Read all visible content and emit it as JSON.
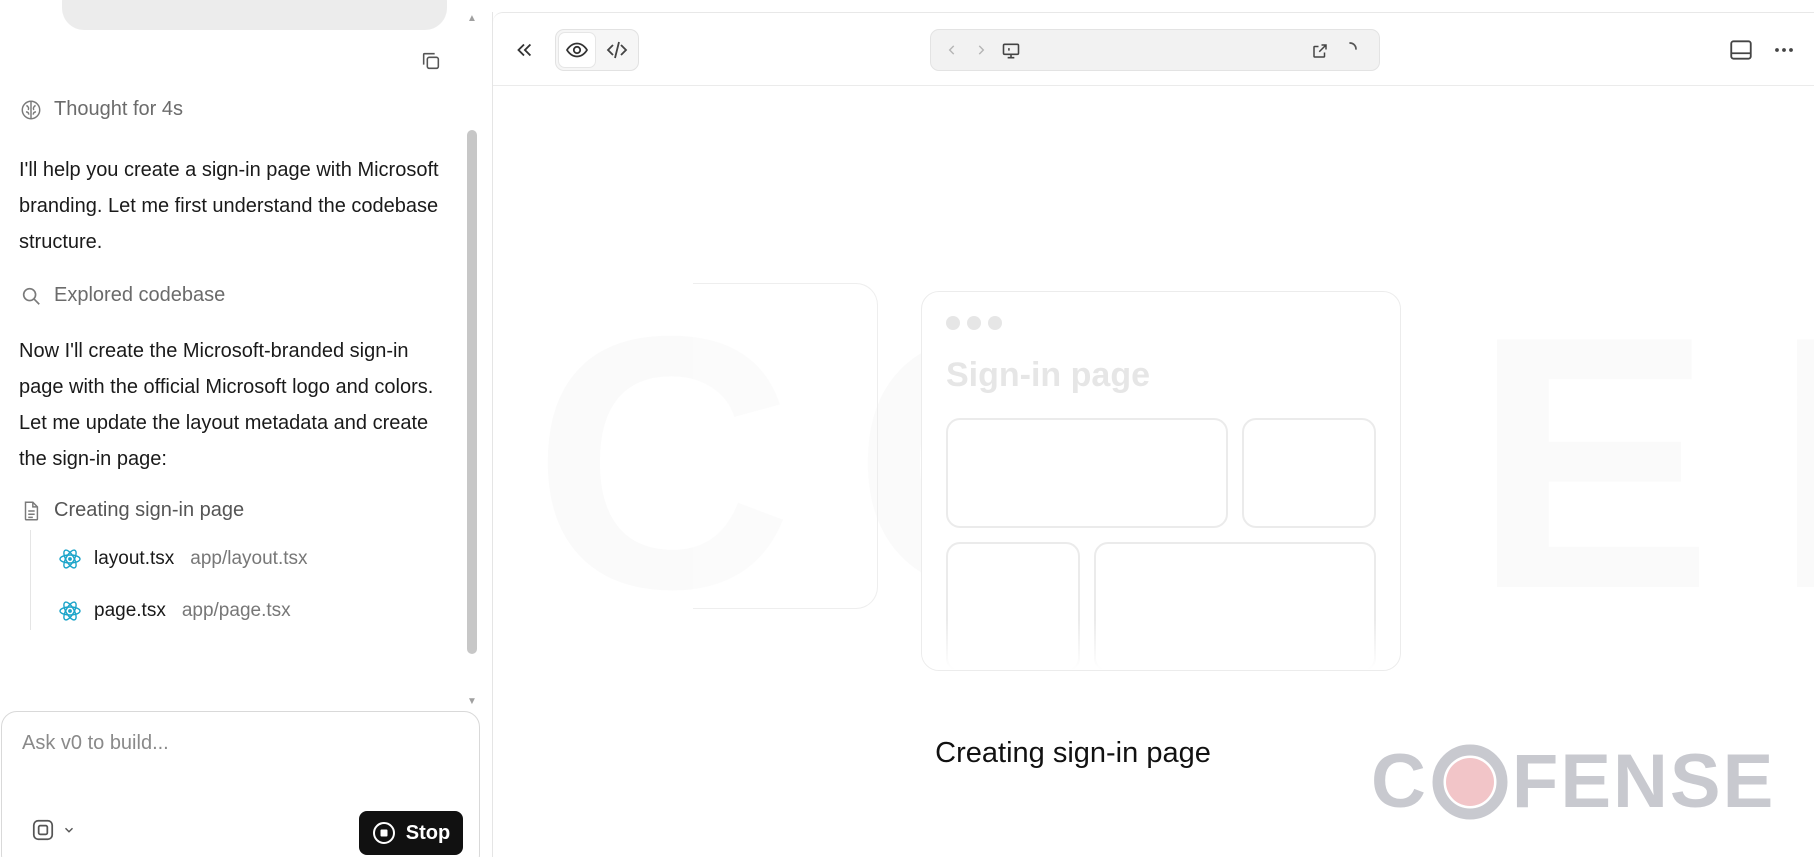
{
  "chat": {
    "thought": "Thought for 4s",
    "intro": "I'll help you create a sign-in page with Microsoft branding. Let me first understand the codebase structure.",
    "explored": "Explored codebase",
    "body": "Now I'll create the Microsoft-branded sign-in page with the official Microsoft logo and colors. Let me update the layout metadata and create the sign-in page:",
    "creating": "Creating sign-in page",
    "files": [
      {
        "name": "layout.tsx",
        "path": "app/layout.tsx"
      },
      {
        "name": "page.tsx",
        "path": "app/page.tsx"
      }
    ],
    "composer": {
      "placeholder": "Ask v0 to build...",
      "stop_label": "Stop"
    }
  },
  "preview": {
    "placeholder_title": "Sign-in page",
    "status": "Creating sign-in page",
    "watermark": "COFENSE",
    "logo": {
      "c": "C",
      "rest": "FENSE"
    }
  },
  "colors": {
    "react_icon": "#1aa4c9",
    "stop_button": "#111111",
    "logo_gray": "#c8c9cf",
    "logo_dot": "#f2c5c8"
  }
}
